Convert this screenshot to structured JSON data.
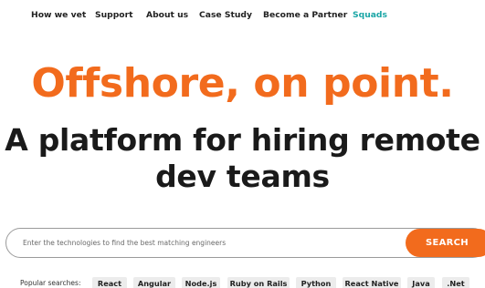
{
  "nav": {
    "items": [
      {
        "label": "How we vet"
      },
      {
        "label": "Support"
      },
      {
        "label": "About us"
      },
      {
        "label": "Case Study"
      },
      {
        "label": "Become a Partner"
      },
      {
        "label": "Squads"
      }
    ],
    "accent_color": "#1aa6a6"
  },
  "hero": {
    "headline": "Offshore, on point.",
    "subline_1": "A platform for hiring remote",
    "subline_2": "dev teams",
    "headline_color": "#f26b1d"
  },
  "search": {
    "placeholder": "Enter the technologies to find the best matching engineers",
    "button_label": "SEARCH",
    "button_color": "#f26b1d"
  },
  "popular": {
    "label": "Popular searches:",
    "chips": [
      "React",
      "Angular",
      "Node.js",
      "Ruby on Rails",
      "Python",
      "React Native",
      "Java",
      ".Net"
    ]
  }
}
